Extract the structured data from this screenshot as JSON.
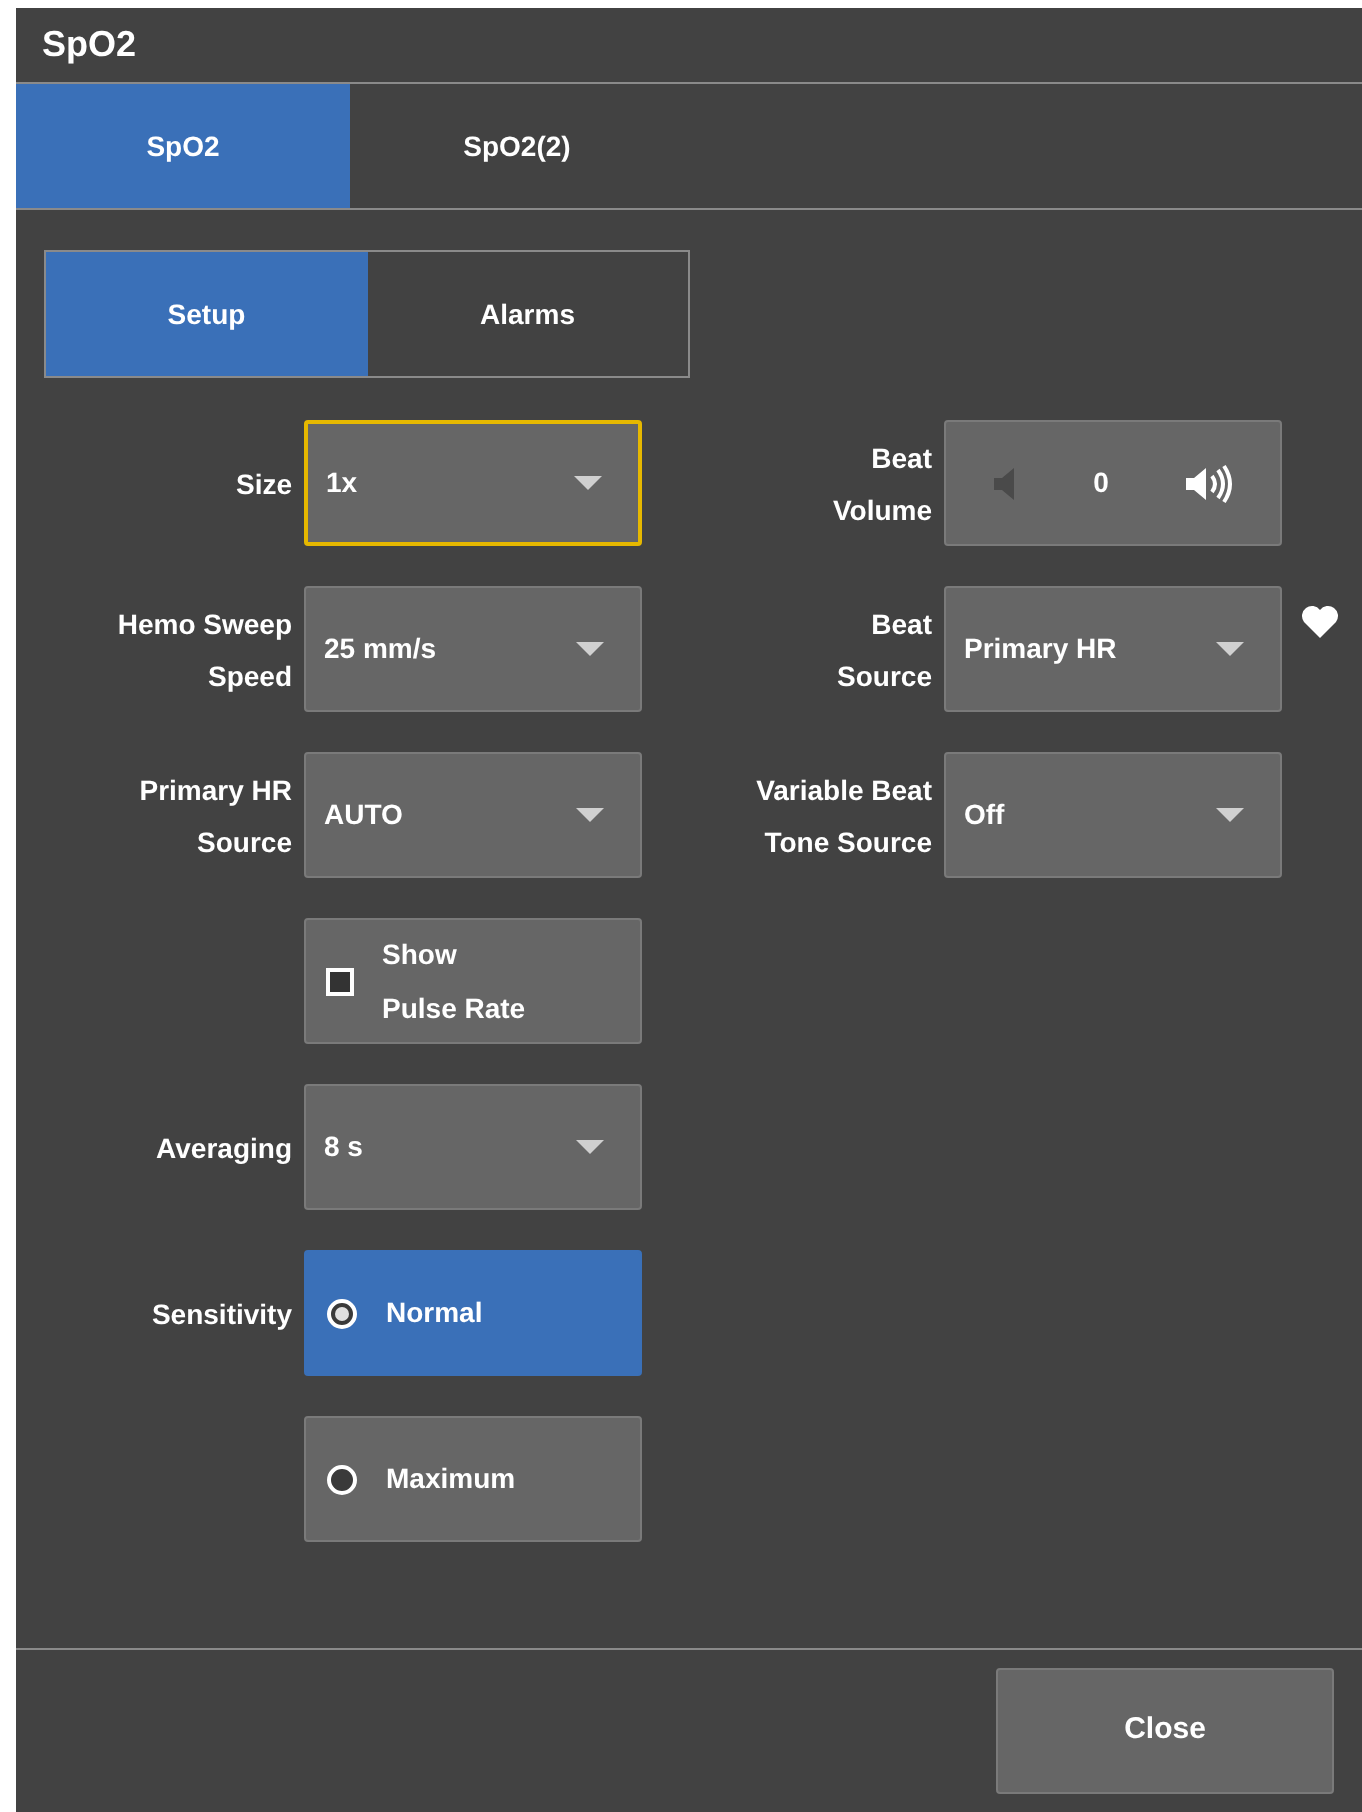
{
  "window": {
    "title": "SpO2"
  },
  "tabs": [
    {
      "label": "SpO2",
      "selected": true
    },
    {
      "label": "SpO2(2)",
      "selected": false
    }
  ],
  "subtabs": [
    {
      "label": "Setup",
      "selected": true
    },
    {
      "label": "Alarms",
      "selected": false
    }
  ],
  "left_settings": [
    {
      "kind": "dropdown",
      "label": "Size",
      "value": "1x",
      "focused": true
    },
    {
      "kind": "dropdown",
      "label": "Hemo Sweep\nSpeed",
      "value": "25 mm/s",
      "focused": false
    },
    {
      "kind": "dropdown",
      "label": "Primary HR\nSource",
      "value": "AUTO",
      "focused": false
    },
    {
      "kind": "checkbox",
      "value": "Show\nPulse Rate",
      "checked": false
    },
    {
      "kind": "dropdown",
      "label": "Averaging",
      "value": "8 s",
      "focused": false
    },
    {
      "kind": "radio",
      "label": "Sensitivity",
      "value": "Normal",
      "selected": true
    },
    {
      "kind": "radio",
      "value": "Maximum",
      "selected": false
    }
  ],
  "right_settings": [
    {
      "kind": "volume",
      "label": "Beat\nVolume",
      "value": "0"
    },
    {
      "kind": "dropdown",
      "label": "Beat\nSource",
      "value": "Primary HR",
      "focused": false,
      "heart": true
    },
    {
      "kind": "dropdown",
      "label": "Variable Beat\nTone Source",
      "value": "Off",
      "focused": false
    }
  ],
  "footer": {
    "close_button": "Close"
  }
}
